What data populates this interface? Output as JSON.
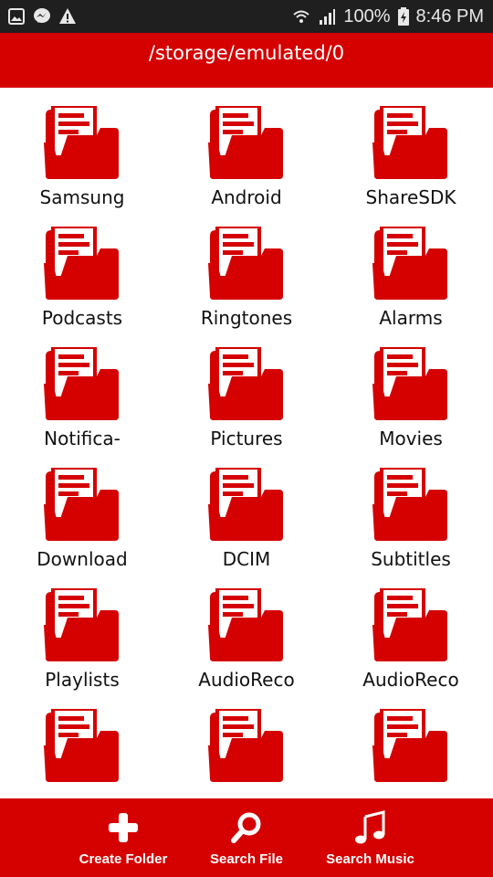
{
  "status_bar": {
    "battery": "100%",
    "time": "8:46 PM",
    "icons": [
      "gallery-icon",
      "messenger-icon",
      "warning-icon",
      "wifi-icon",
      "signal-icon",
      "battery-icon"
    ]
  },
  "header": {
    "path": "/storage/emulated/0"
  },
  "folders": [
    {
      "label": "Samsung"
    },
    {
      "label": "Android"
    },
    {
      "label": "ShareSDK"
    },
    {
      "label": "Podcasts"
    },
    {
      "label": "Ringtones"
    },
    {
      "label": "Alarms"
    },
    {
      "label": "Notifica-"
    },
    {
      "label": "Pictures"
    },
    {
      "label": "Movies"
    },
    {
      "label": "Download"
    },
    {
      "label": "DCIM"
    },
    {
      "label": "Subtitles"
    },
    {
      "label": "Playlists"
    },
    {
      "label": "AudioReco"
    },
    {
      "label": "AudioReco"
    },
    {
      "label": ""
    },
    {
      "label": ""
    },
    {
      "label": ""
    }
  ],
  "toolbar": {
    "create_folder": "Create Folder",
    "search_file": "Search File",
    "search_music": "Search Music"
  },
  "colors": {
    "accent": "#d50000",
    "status_bar": "#1f1f1f",
    "text": "#111111"
  }
}
